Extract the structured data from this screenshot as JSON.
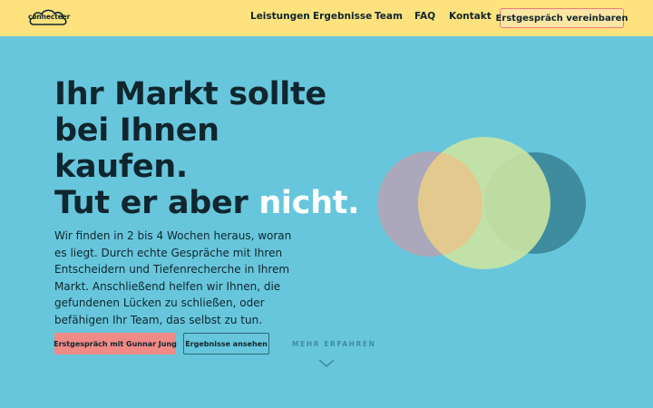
{
  "header": {
    "logo_text": "connecteer",
    "nav": [
      "Leistungen",
      "Ergebnisse",
      "Team",
      "FAQ",
      "Kontakt"
    ],
    "cta": "Erstgespräch vereinbaren"
  },
  "hero": {
    "headline_lines": [
      "Ihr Markt sollte",
      "bei Ihnen",
      "kaufen."
    ],
    "headline_last_prefix": "Tut er aber ",
    "headline_last_accent": "nicht.",
    "body": "Wir finden in 2 bis 4 Wochen heraus, woran es liegt. Durch echte Gespräche mit Ihren Entscheidern und Tiefenrecherche in Ihrem Markt. Anschließend helfen wir Ihnen, die gefundenen Lücken zu schließen, oder befähigen Ihr Team, das selbst zu tun.",
    "primary_button": "Erstgespräch mit Gunnar Jung",
    "secondary_button": "Ergebnisse ansehen",
    "more_link": "MEHR ERFAHREN"
  },
  "colors": {
    "background": "#67c6dc",
    "header": "#fee27e",
    "text": "#10262e",
    "accent": "#f08a86",
    "circle_left": "#aaa8ba",
    "circle_middle": "#c9e3a3",
    "circle_right": "#3e8c9e"
  },
  "icons": {
    "scroll": "chevron-down-icon",
    "logo": "cloud-logo-icon"
  }
}
